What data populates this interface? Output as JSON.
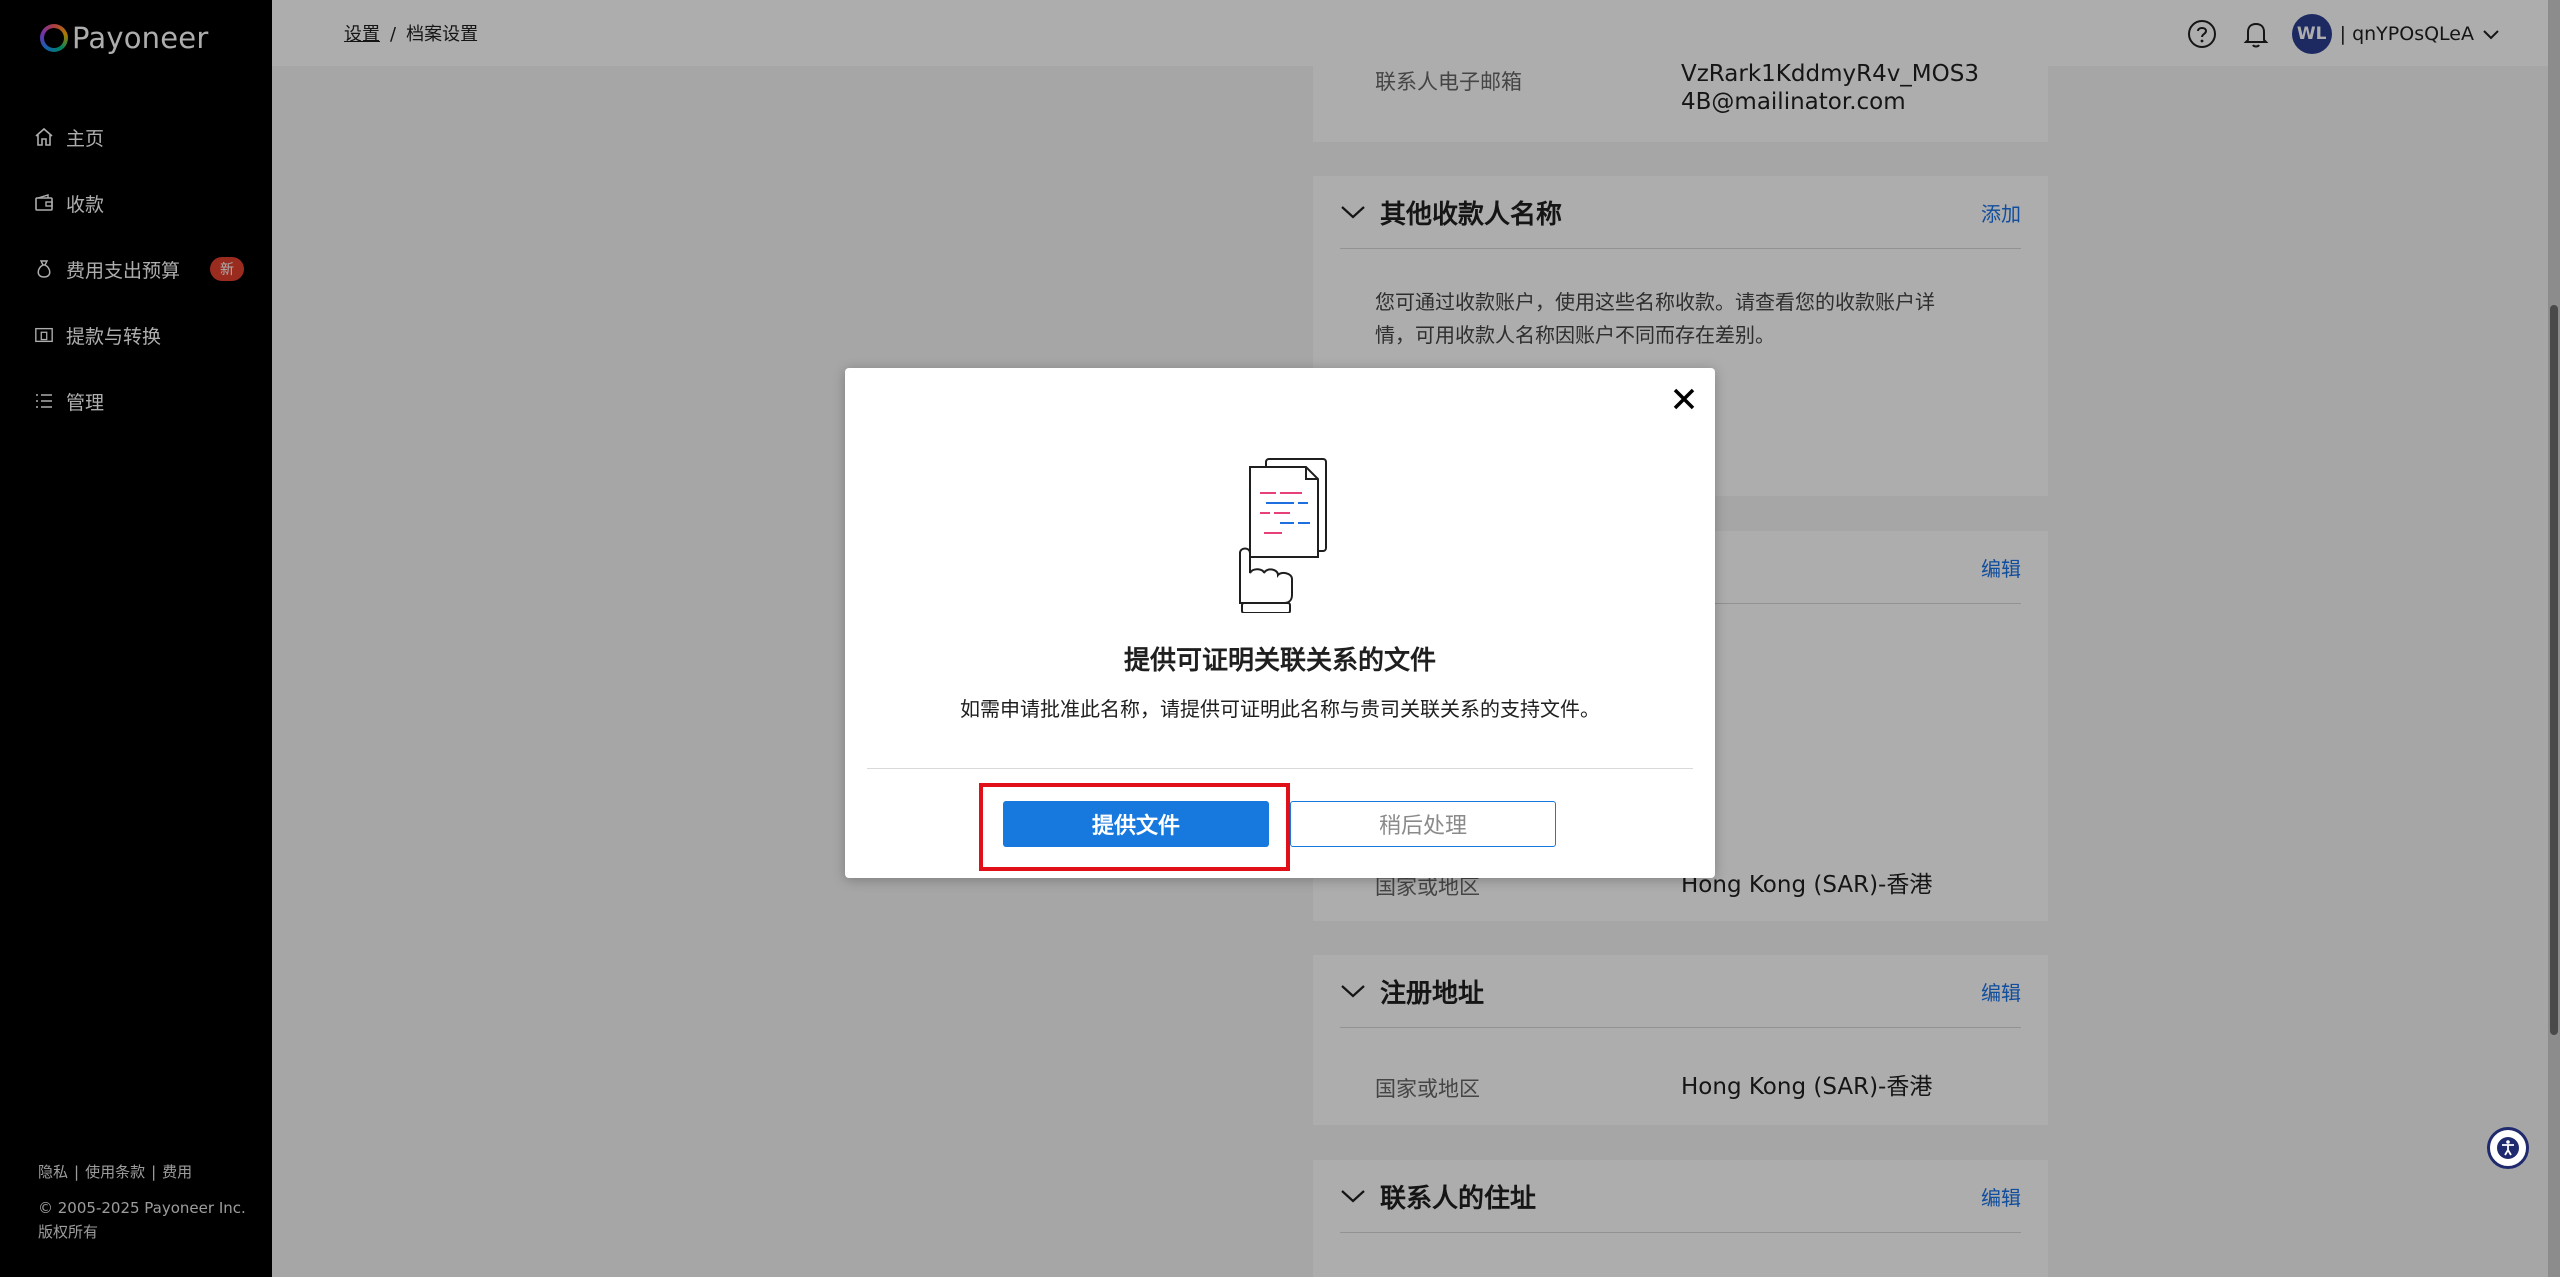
{
  "brand": {
    "name": "Payoneer"
  },
  "sidebar": {
    "items": [
      {
        "label": "主页",
        "icon": "home-icon"
      },
      {
        "label": "收款",
        "icon": "wallet-icon"
      },
      {
        "label": "费用支出预算",
        "icon": "moneybag-icon",
        "badge": "新"
      },
      {
        "label": "提款与转换",
        "icon": "withdraw-icon"
      },
      {
        "label": "管理",
        "icon": "list-icon"
      }
    ],
    "footer": {
      "links": [
        "隐私",
        "使用条款",
        "费用"
      ],
      "copyright": "© 2005-2025 Payoneer Inc.",
      "rights": "版权所有"
    }
  },
  "header": {
    "breadcrumb": {
      "parent": "设置",
      "separator": "/",
      "current": "档案设置"
    },
    "avatar_initials": "WL",
    "username": "qnYPOsQLeA",
    "divider": "|"
  },
  "main": {
    "contact_email": {
      "label": "联系人电子邮箱",
      "value_line1": "VzRark1KddmyR4v_MOS3",
      "value_line2": "4B@mailinator.com"
    },
    "other_names": {
      "title": "其他收款人名称",
      "action": "添加",
      "text_line1": "您可通过收款账户，使用这些名称收款。请查看您的收款账户详",
      "text_line2": "情，可用收款人名称因账户不同而存在差别。"
    },
    "hidden_card": {
      "action": "编辑",
      "country_label": "国家或地区",
      "country_value": "Hong Kong (SAR)-香港"
    },
    "registered_address": {
      "title": "注册地址",
      "action": "编辑",
      "country_label": "国家或地区",
      "country_value": "Hong Kong (SAR)-香港"
    },
    "contact_address": {
      "title": "联系人的住址",
      "action": "编辑"
    }
  },
  "modal": {
    "title": "提供可证明关联关系的文件",
    "description": "如需申请批准此名称，请提供可证明此名称与贵司关联关系的支持文件。",
    "primary_button": "提供文件",
    "secondary_button": "稍后处理"
  },
  "colors": {
    "primary": "#1778dd",
    "link": "#1a73e8",
    "sidebar_bg": "#000000",
    "badge": "#e3412f",
    "highlight": "#e10f17",
    "avatar": "#2b3d90"
  }
}
